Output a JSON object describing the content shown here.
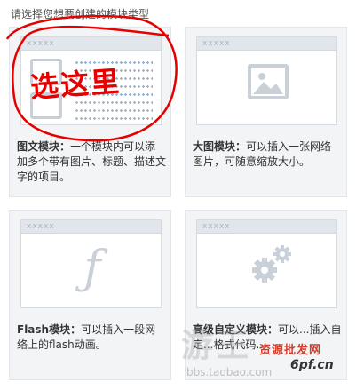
{
  "prompt": "请选择您想要创建的模块类型",
  "cards": [
    {
      "title": "图文模块",
      "sep": "：",
      "desc": "一个模块内可以添加多个带有图片、标题、描述文字的项目。",
      "bar": "xxxxx"
    },
    {
      "title": "大图模块",
      "sep": "：",
      "desc": "可以插入一张网络图片，可随意缩放大小。",
      "bar": "xxxxx"
    },
    {
      "title": "Flash模块",
      "sep": "：",
      "desc": "可以插入一段网络上的flash动画。",
      "bar": "xxxxx"
    },
    {
      "title": "高级自定义模块",
      "sep": "：",
      "desc": "可以...插入自定...格式代码...",
      "bar": "xxxxx"
    }
  ],
  "annotation": {
    "text": "选这里",
    "color": "#e60000"
  },
  "watermarks": {
    "big": "游王",
    "url": "bbs.taobao.com",
    "site_cn": "资源批发网",
    "site_en": "6pf.cn"
  },
  "icons": {
    "image": "image-icon",
    "flash": "flash-icon",
    "gears": "gears-icon"
  },
  "colors": {
    "card_bg": "#f3f4f6",
    "icon_gray": "#c9d0d8",
    "annotation_red": "#e60000"
  }
}
